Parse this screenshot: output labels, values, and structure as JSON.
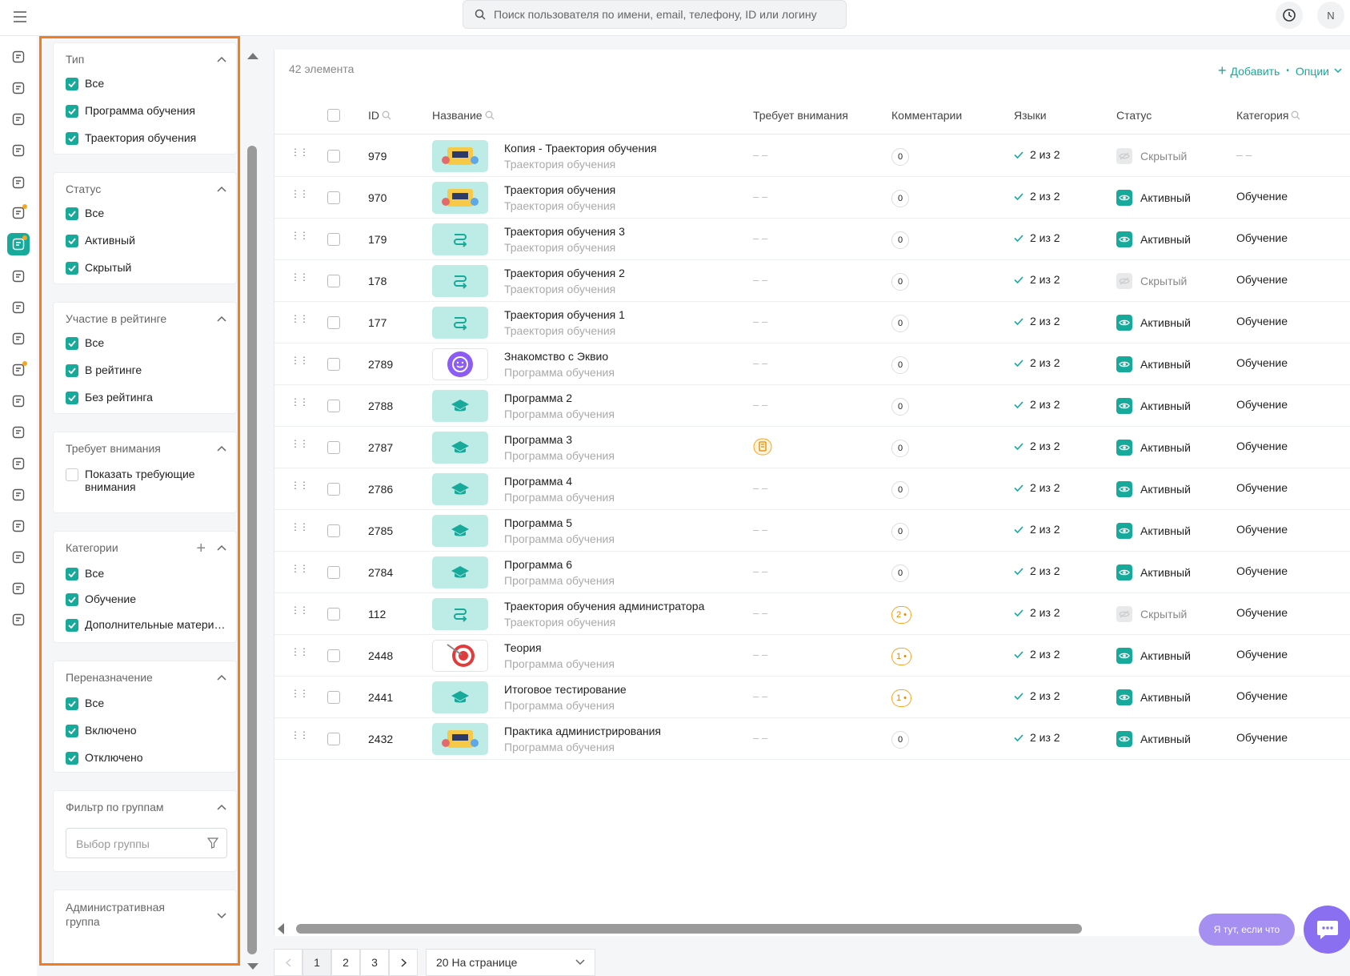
{
  "search": {
    "placeholder": "Поиск пользователя по имени, email, телефону, ID или логину"
  },
  "user": {
    "initial": "N"
  },
  "colors": {
    "accent": "#17a99a",
    "highlight": "#f47b20",
    "warning": "#f5a623"
  },
  "filters": {
    "type": {
      "title": "Тип",
      "options": [
        "Все",
        "Программа обучения",
        "Траектория обучения"
      ]
    },
    "status": {
      "title": "Статус",
      "options": [
        "Все",
        "Активный",
        "Скрытый"
      ]
    },
    "rating": {
      "title": "Участие в рейтинге",
      "options": [
        "Все",
        "В рейтинге",
        "Без рейтинга"
      ]
    },
    "attention": {
      "title": "Требует внимания",
      "option_line1": "Показать требующие",
      "option_line2": "внимания"
    },
    "categories": {
      "title": "Категории",
      "options": [
        "Все",
        "Обучение",
        "Дополнительные матери…"
      ]
    },
    "reassign": {
      "title": "Переназначение",
      "options": [
        "Все",
        "Включено",
        "Отключено"
      ]
    },
    "groups": {
      "title": "Фильтр по группам",
      "placeholder": "Выбор группы"
    },
    "admin": {
      "title_line1": "Административная",
      "title_line2": "группа"
    }
  },
  "list": {
    "count": "42 элемента",
    "add": "Добавить",
    "options": "Опции",
    "columns": {
      "id": "ID",
      "name": "Название",
      "attention": "Требует внимания",
      "comments": "Комментарии",
      "languages": "Языки",
      "status": "Статус",
      "category": "Категория"
    },
    "rows": [
      {
        "id": "979",
        "name": "Копия - Траектория обучения",
        "sub": "Траектория обучения",
        "thumb": "pic",
        "attn": "– –",
        "comm": "0",
        "lang": "2 из 2",
        "status": "Скрытый",
        "cat": "– –"
      },
      {
        "id": "970",
        "name": "Траектория обучения",
        "sub": "Траектория обучения",
        "thumb": "pic",
        "attn": "– –",
        "comm": "0",
        "lang": "2 из 2",
        "status": "Активный",
        "cat": "Обучение"
      },
      {
        "id": "179",
        "name": "Траектория обучения 3",
        "sub": "Траектория обучения",
        "thumb": "route",
        "attn": "– –",
        "comm": "0",
        "lang": "2 из 2",
        "status": "Активный",
        "cat": "Обучение"
      },
      {
        "id": "178",
        "name": "Траектория обучения 2",
        "sub": "Траектория обучения",
        "thumb": "route",
        "attn": "– –",
        "comm": "0",
        "lang": "2 из 2",
        "status": "Скрытый",
        "cat": "Обучение"
      },
      {
        "id": "177",
        "name": "Траектория обучения 1",
        "sub": "Траектория обучения",
        "thumb": "route",
        "attn": "– –",
        "comm": "0",
        "lang": "2 из 2",
        "status": "Активный",
        "cat": "Обучение"
      },
      {
        "id": "2789",
        "name": "Знакомство с Эквио",
        "sub": "Программа обучения",
        "thumb": "smile",
        "attn": "– –",
        "comm": "0",
        "lang": "2 из 2",
        "status": "Активный",
        "cat": "Обучение"
      },
      {
        "id": "2788",
        "name": "Программа 2",
        "sub": "Программа обучения",
        "thumb": "cap",
        "attn": "– –",
        "comm": "0",
        "lang": "2 из 2",
        "status": "Активный",
        "cat": "Обучение"
      },
      {
        "id": "2787",
        "name": "Программа 3",
        "sub": "Программа обучения",
        "thumb": "cap",
        "attn": "doc",
        "comm": "0",
        "lang": "2 из 2",
        "status": "Активный",
        "cat": "Обучение"
      },
      {
        "id": "2786",
        "name": "Программа 4",
        "sub": "Программа обучения",
        "thumb": "cap",
        "attn": "– –",
        "comm": "0",
        "lang": "2 из 2",
        "status": "Активный",
        "cat": "Обучение"
      },
      {
        "id": "2785",
        "name": "Программа 5",
        "sub": "Программа обучения",
        "thumb": "cap",
        "attn": "– –",
        "comm": "0",
        "lang": "2 из 2",
        "status": "Активный",
        "cat": "Обучение"
      },
      {
        "id": "2784",
        "name": "Программа 6",
        "sub": "Программа обучения",
        "thumb": "cap",
        "attn": "– –",
        "comm": "0",
        "lang": "2 из 2",
        "status": "Активный",
        "cat": "Обучение"
      },
      {
        "id": "112",
        "name": "Траектория обучения администратора",
        "sub": "Траектория обучения",
        "thumb": "route",
        "attn": "– –",
        "comm": "2 •",
        "lang": "2 из 2",
        "status": "Скрытый",
        "cat": "Обучение"
      },
      {
        "id": "2448",
        "name": "Теория",
        "sub": "Программа обучения",
        "thumb": "target",
        "attn": "– –",
        "comm": "1 •",
        "lang": "2 из 2",
        "status": "Активный",
        "cat": "Обучение"
      },
      {
        "id": "2441",
        "name": "Итоговое тестирование",
        "sub": "Программа обучения",
        "thumb": "cap",
        "attn": "– –",
        "comm": "1 •",
        "lang": "2 из 2",
        "status": "Активный",
        "cat": "Обучение"
      },
      {
        "id": "2432",
        "name": "Практика администрирования",
        "sub": "Программа обучения",
        "thumb": "pic",
        "attn": "– –",
        "comm": "0",
        "lang": "2 из 2",
        "status": "Активный",
        "cat": "Обучение"
      }
    ]
  },
  "pagination": {
    "pages": [
      "1",
      "2",
      "3"
    ],
    "per_page": "20 На странице"
  },
  "help": {
    "bubble": "Я тут, если что"
  }
}
